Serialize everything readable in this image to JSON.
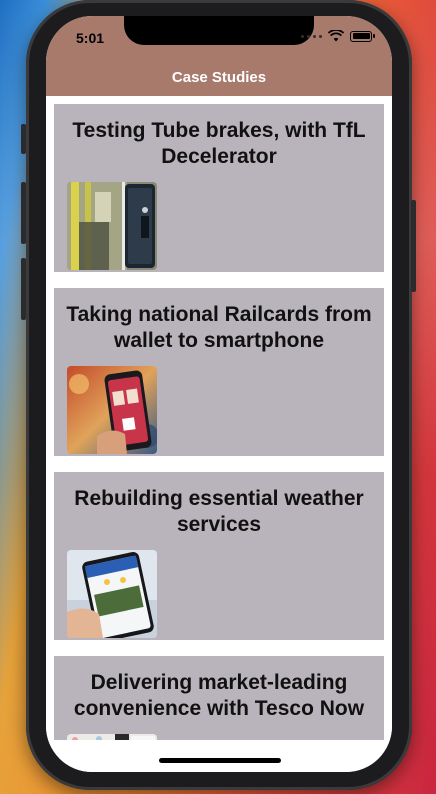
{
  "status_bar": {
    "time": "5:01"
  },
  "nav": {
    "title": "Case Studies"
  },
  "cards": [
    {
      "title": "Testing Tube brakes, with TfL Decelerator"
    },
    {
      "title": "Taking national Railcards from wallet to smartphone"
    },
    {
      "title": "Rebuilding essential weather services"
    },
    {
      "title": "Delivering market-leading convenience with Tesco Now"
    }
  ],
  "colors": {
    "header": "#a87a6c",
    "card_background": "#b9b4bb",
    "nav_title": "#ffffff"
  }
}
